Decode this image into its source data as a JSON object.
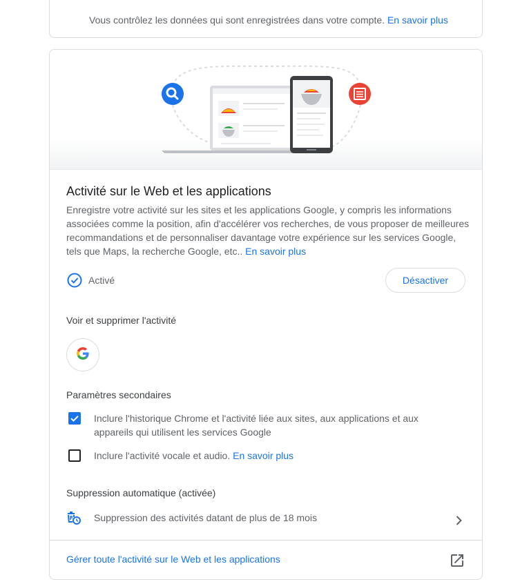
{
  "top_note": {
    "text": "Vous contrôlez les données qui sont enregistrées dans votre compte.",
    "link": "En savoir plus"
  },
  "card": {
    "illustration": "web-and-app-activity-illustration",
    "title": "Activité sur le Web et les applications",
    "description": "Enregistre votre activité sur les sites et les applications Google, y compris les informations associées comme la position, afin d'accélérer vos recherches, de vous proposer de meilleures recommandations et de personnaliser davantage votre expérience sur les services Google, tels que Maps, la recherche Google, etc..",
    "description_link": "En savoir plus",
    "status": {
      "icon": "check-circle-icon",
      "label": "Activé"
    },
    "disable_button": "Désactiver",
    "view_delete": {
      "heading": "Voir et supprimer l'activité",
      "app_icon": "google-g-icon"
    },
    "secondary": {
      "heading": "Paramètres secondaires",
      "options": [
        {
          "label": "Inclure l'historique Chrome et l'activité liée aux sites, aux applications et aux appareils qui utilisent les services Google",
          "checked": true
        },
        {
          "label": "Inclure l'activité vocale et audio.",
          "link": "En savoir plus",
          "checked": false
        }
      ]
    },
    "auto_delete": {
      "heading": "Suppression automatique (activée)",
      "icon": "auto-delete-icon",
      "label": "Suppression des activités datant de plus de 18 mois",
      "chevron": "chevron-right-icon"
    },
    "footer": {
      "label": "Gérer toute l'activité sur le Web et les applications",
      "icon": "open-in-new-icon"
    }
  },
  "colors": {
    "accent": "#1a73e8",
    "text_primary": "#202124",
    "text_secondary": "#5f6368",
    "border": "#dadce0",
    "search_badge": "#1a73e8",
    "doc_badge": "#ea4335"
  }
}
